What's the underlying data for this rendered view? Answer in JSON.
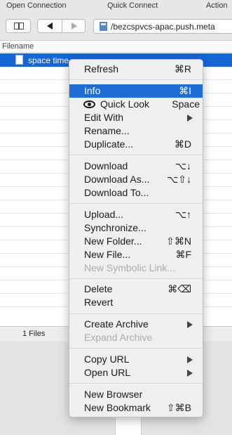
{
  "toolbar": {
    "open_connection": "Open Connection",
    "quick_connect": "Quick Connect",
    "action": "Action"
  },
  "path_bar": {
    "path": "/bezcspvcs-apac.push.meta"
  },
  "file_list": {
    "header": "Filename",
    "selected_file": "space time"
  },
  "status": {
    "files_count": "1 Files"
  },
  "context_menu": {
    "refresh": {
      "label": "Refresh",
      "shortcut": "⌘R"
    },
    "info": {
      "label": "Info",
      "shortcut": "⌘I"
    },
    "quick_look": {
      "label": "Quick Look",
      "shortcut": "Space",
      "icon": "eye-icon"
    },
    "edit_with": {
      "label": "Edit With"
    },
    "rename": {
      "label": "Rename..."
    },
    "duplicate": {
      "label": "Duplicate...",
      "shortcut": "⌘D"
    },
    "download": {
      "label": "Download",
      "shortcut": "⌥↓"
    },
    "download_as": {
      "label": "Download As...",
      "shortcut": "⌥⇧↓"
    },
    "download_to": {
      "label": "Download To..."
    },
    "upload": {
      "label": "Upload...",
      "shortcut": "⌥↑"
    },
    "synchronize": {
      "label": "Synchronize..."
    },
    "new_folder": {
      "label": "New Folder...",
      "shortcut": "⇧⌘N"
    },
    "new_file": {
      "label": "New File...",
      "shortcut": "⌘F"
    },
    "new_symbolic_link": {
      "label": "New Symbolic Link..."
    },
    "delete": {
      "label": "Delete",
      "shortcut": "⌘⌫"
    },
    "revert": {
      "label": "Revert"
    },
    "create_archive": {
      "label": "Create Archive"
    },
    "expand_archive": {
      "label": "Expand Archive"
    },
    "copy_url": {
      "label": "Copy URL"
    },
    "open_url": {
      "label": "Open URL"
    },
    "new_browser": {
      "label": "New Browser"
    },
    "new_bookmark": {
      "label": "New Bookmark",
      "shortcut": "⇧⌘B"
    }
  },
  "colors": {
    "selection": "#1565d5",
    "menu_highlight": "#1e6ed6"
  }
}
